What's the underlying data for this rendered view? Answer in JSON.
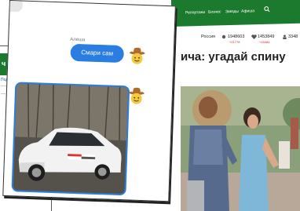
{
  "site": {
    "nav": [
      "Репортажи",
      "Бизнес",
      "Звезды",
      "Афиша"
    ],
    "region": "Россия",
    "stats": {
      "views": "1948603",
      "views_delta": "+21778",
      "likes": "1453849",
      "likes_delta": "+15484",
      "third": "3348"
    },
    "headline": "ича: угадай спину"
  },
  "mid_page": {
    "header_char": "ч",
    "link_text": "Под"
  },
  "chat": {
    "sender": "Алёша",
    "message": "Смари сам"
  },
  "colors": {
    "nav_green": "#1c7a2e",
    "bubble_blue": "#2a7de1"
  }
}
